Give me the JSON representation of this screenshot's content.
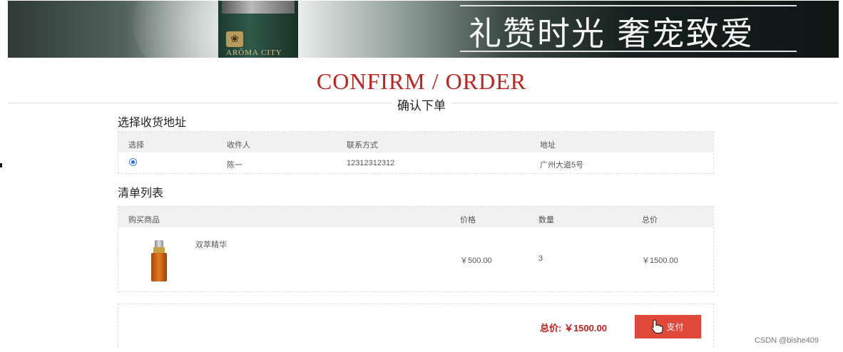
{
  "banner": {
    "slogan": "礼赞时光 奢宠致爱",
    "brand": "ARŌMA CITY",
    "logo_glyph": "❀"
  },
  "page": {
    "title": "CONFIRM / ORDER",
    "subtitle": "确认下单"
  },
  "address": {
    "section_title": "选择收货地址",
    "columns": [
      "选择",
      "收件人",
      "联系方式",
      "地址"
    ],
    "rows": [
      {
        "selected": true,
        "recipient": "陈一",
        "phone": "12312312312",
        "address": "广州大道5号"
      }
    ]
  },
  "order": {
    "section_title": "清单列表",
    "columns": [
      "购买商品",
      "价格",
      "数量",
      "总价"
    ],
    "items": [
      {
        "name": "双萃精华",
        "price": "￥500.00",
        "quantity": "3",
        "subtotal": "￥1500.00"
      }
    ]
  },
  "summary": {
    "total_label": "总价:",
    "total_value": "￥1500.00",
    "pay_label": "支付"
  },
  "watermark": "CSDN @bishe409",
  "colors": {
    "accent": "#c0231e",
    "pay_button": "#e0493a",
    "header_bg": "#f1f1f1",
    "radio": "#1d6fe0"
  },
  "icons": {
    "cursor": "hand-pointer-icon",
    "radio": "radio-selected-icon"
  }
}
